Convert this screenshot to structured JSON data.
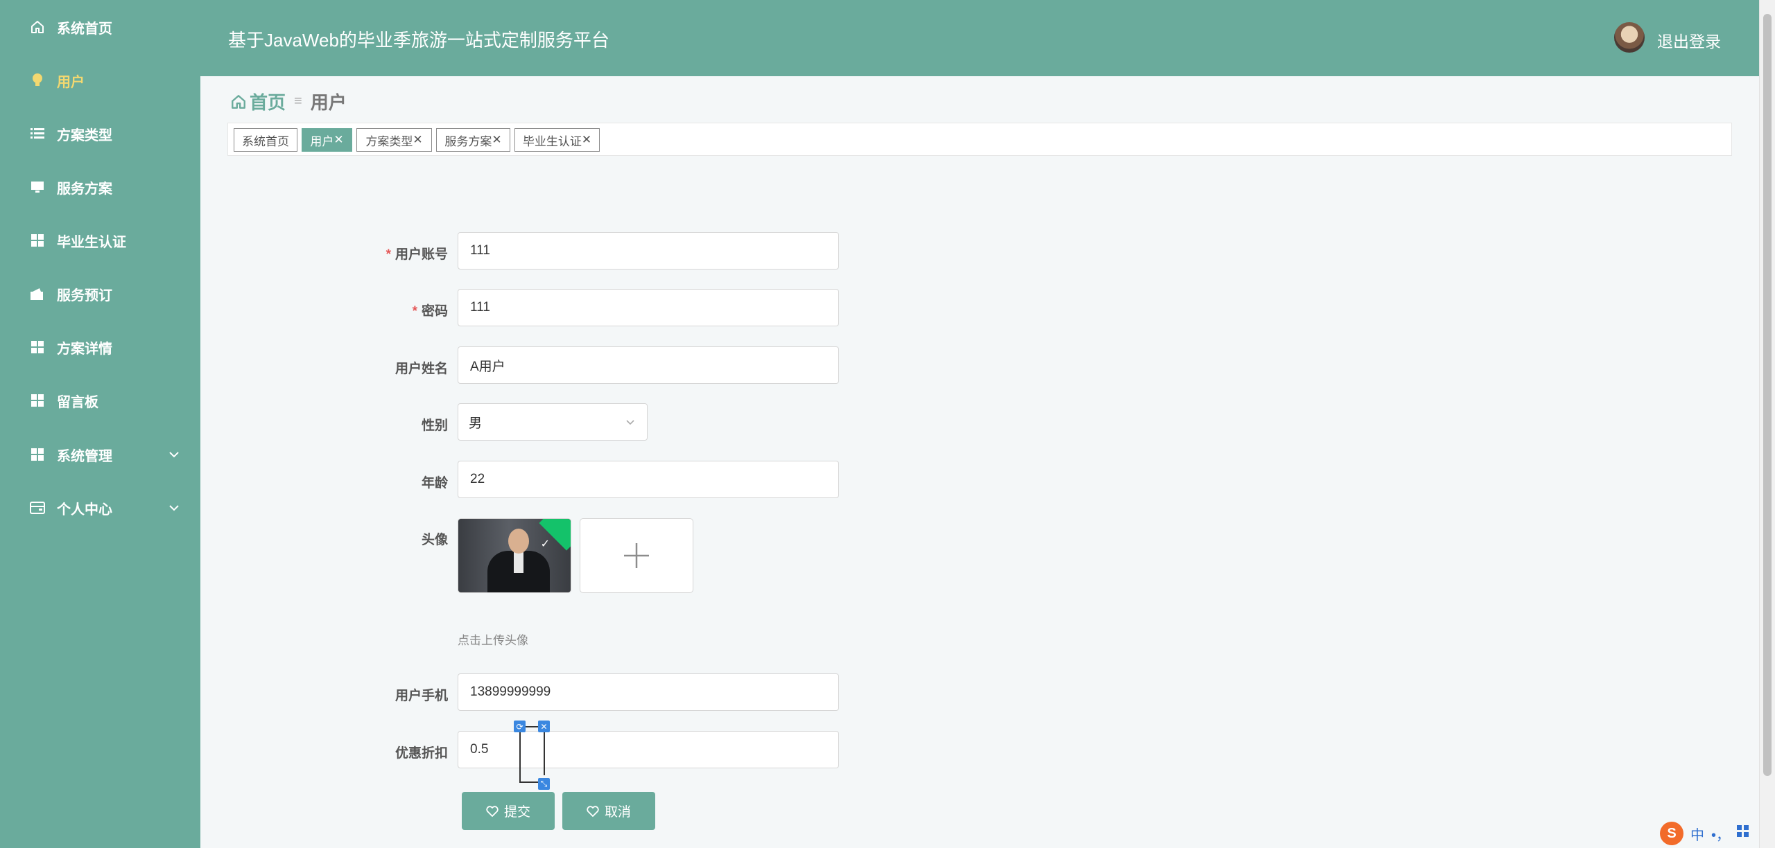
{
  "app": {
    "title": "基于JavaWeb的毕业季旅游一站式定制服务平台",
    "logout_label": "退出登录"
  },
  "sidebar": {
    "items": [
      {
        "label": "系统首页",
        "icon": "home-icon"
      },
      {
        "label": "用户",
        "icon": "lightbulb-icon",
        "active": true
      },
      {
        "label": "方案类型",
        "icon": "list-icon"
      },
      {
        "label": "服务方案",
        "icon": "monitor-icon"
      },
      {
        "label": "毕业生认证",
        "icon": "grid-icon"
      },
      {
        "label": "服务预订",
        "icon": "wallet-icon"
      },
      {
        "label": "方案详情",
        "icon": "grid-icon"
      },
      {
        "label": "留言板",
        "icon": "grid-icon"
      },
      {
        "label": "系统管理",
        "icon": "grid-icon",
        "expandable": true
      },
      {
        "label": "个人中心",
        "icon": "card-icon",
        "expandable": true
      }
    ]
  },
  "breadcrumb": {
    "home": "首页",
    "current": "用户"
  },
  "tags": [
    {
      "label": "系统首页",
      "closable": false
    },
    {
      "label": "用户",
      "closable": true,
      "active": true
    },
    {
      "label": "方案类型",
      "closable": true
    },
    {
      "label": "服务方案",
      "closable": true
    },
    {
      "label": "毕业生认证",
      "closable": true
    }
  ],
  "form": {
    "account": {
      "label": "用户账号",
      "value": "111",
      "required": true
    },
    "password": {
      "label": "密码",
      "value": "111",
      "required": true
    },
    "name": {
      "label": "用户姓名",
      "value": "A用户"
    },
    "gender": {
      "label": "性别",
      "value": "男"
    },
    "age": {
      "label": "年龄",
      "value": "22"
    },
    "avatar": {
      "label": "头像",
      "hint": "点击上传头像"
    },
    "phone": {
      "label": "用户手机",
      "value": "13899999999"
    },
    "discount": {
      "label": "优惠折扣",
      "value": "0.5"
    },
    "submit_label": "提交",
    "cancel_label": "取消"
  },
  "ime": {
    "mode": "中",
    "punct": "•，"
  },
  "colors": {
    "primary": "#6aab9c",
    "active_menu": "#f3d870",
    "required": "#e45656",
    "success_corner": "#14c26a"
  }
}
